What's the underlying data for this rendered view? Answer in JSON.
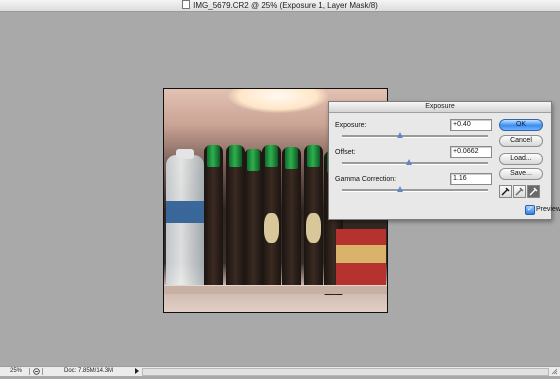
{
  "window": {
    "title": "IMG_5679.CR2 @ 25% (Exposure 1, Layer Mask/8)"
  },
  "dialog": {
    "title": "Exposure",
    "fields": [
      {
        "label": "Exposure:",
        "value": "+0.40",
        "slider_level": 0.4
      },
      {
        "label": "Offset:",
        "value": "+0.0662",
        "slider_level": 0.46
      },
      {
        "label": "Gamma Correction:",
        "value": "1.16",
        "slider_level": 0.4
      }
    ],
    "buttons": {
      "ok": "OK",
      "cancel": "Cancel",
      "load": "Load...",
      "save": "Save..."
    },
    "preview": {
      "label": "Preview",
      "checked": true
    },
    "eyedroppers": [
      "black-point-eyedropper-icon",
      "gray-point-eyedropper-icon",
      "white-point-eyedropper-icon"
    ]
  },
  "statusbar": {
    "zoom": "25%",
    "doc": "Doc: 7.85M/14.3M"
  },
  "colors": {
    "canvas_bg": "#a9a9a9",
    "ok_button": "#3c8cf0",
    "slider_thumb": "#5f88c6"
  }
}
